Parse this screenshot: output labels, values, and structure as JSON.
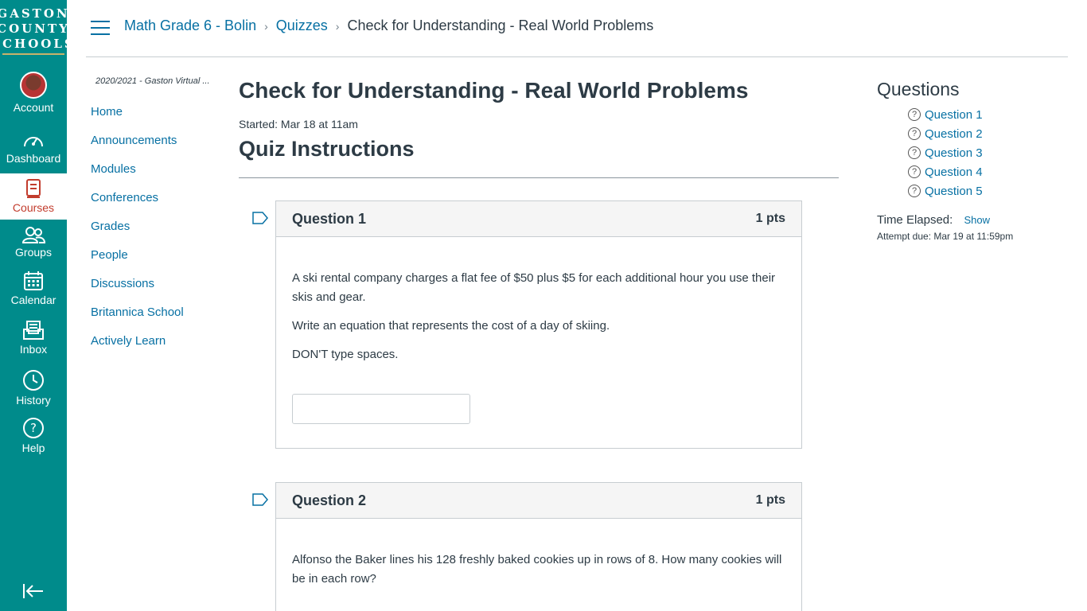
{
  "logo": {
    "lines": [
      "GASTON",
      "COUNTY",
      "SCHOOLS"
    ]
  },
  "global_nav": {
    "items": [
      {
        "label": "Account",
        "icon": "avatar"
      },
      {
        "label": "Dashboard",
        "icon": "dashboard-icon"
      },
      {
        "label": "Courses",
        "icon": "courses-icon",
        "active": true
      },
      {
        "label": "Groups",
        "icon": "groups-icon"
      },
      {
        "label": "Calendar",
        "icon": "calendar-icon"
      },
      {
        "label": "Inbox",
        "icon": "inbox-icon"
      },
      {
        "label": "History",
        "icon": "history-icon"
      },
      {
        "label": "Help",
        "icon": "help-icon"
      }
    ]
  },
  "breadcrumb": {
    "course": "Math Grade 6 - Bolin",
    "section": "Quizzes",
    "current": "Check for Understanding - Real World Problems"
  },
  "course_nav": {
    "term": "2020/2021 - Gaston Virtual ...",
    "items": [
      "Home",
      "Announcements",
      "Modules",
      "Conferences",
      "Grades",
      "People",
      "Discussions",
      "Britannica School",
      "Actively Learn"
    ]
  },
  "quiz": {
    "title": "Check for Understanding - Real World Problems",
    "started": "Started: Mar 18 at 11am",
    "instructions_heading": "Quiz Instructions",
    "questions": [
      {
        "name": "Question 1",
        "points": "1 pts",
        "text": [
          "A ski rental company charges a flat fee of $50 plus $5 for each additional hour you use their skis and gear.",
          "Write an equation that represents the cost of a day of skiing.",
          "DON'T type spaces."
        ],
        "answer": ""
      },
      {
        "name": "Question 2",
        "points": "1 pts",
        "text": [
          "Alfonso the Baker lines his 128 freshly baked cookies up in rows of 8. How many cookies will be in each row?"
        ]
      }
    ]
  },
  "sidebar": {
    "title": "Questions",
    "questions": [
      "Question 1",
      "Question 2",
      "Question 3",
      "Question 4",
      "Question 5"
    ],
    "question_icon": "?",
    "time_elapsed_label": "Time Elapsed:",
    "show_label": "Show",
    "attempt_due": "Attempt due: Mar 19 at 11:59pm"
  },
  "colors": {
    "nav_bg": "#008b8b",
    "link": "#0770a3",
    "active": "#c23c2d"
  }
}
